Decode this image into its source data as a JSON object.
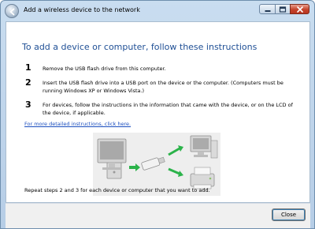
{
  "window": {
    "title": "Add a wireless device to the network"
  },
  "main": {
    "heading": "To add a device or computer, follow these instructions",
    "steps": [
      {
        "number": "1",
        "text": "Remove the USB flash drive from this computer."
      },
      {
        "number": "2",
        "text": "Insert the USB flash drive into a USB port on the device or the computer. (Computers must be running Windows XP or Windows Vista.)"
      },
      {
        "number": "3",
        "text": "For devices, follow the instructions in the information that came with the device, or on the LCD of the device, if applicable."
      }
    ],
    "more_link": "For more detailed instructions, click here.",
    "repeat_text": "Repeat steps 2 and 3 for each device or computer that you want to add."
  },
  "footer": {
    "close_label": "Close"
  },
  "icons": {
    "back": "back-arrow-icon",
    "minimize": "minimize-icon",
    "maximize": "maximize-icon",
    "close": "close-icon",
    "illustration": "usb-transfer-illustration"
  },
  "colors": {
    "heading": "#1f4f95",
    "link": "#1c4fbf",
    "arrow": "#2bb34a"
  }
}
